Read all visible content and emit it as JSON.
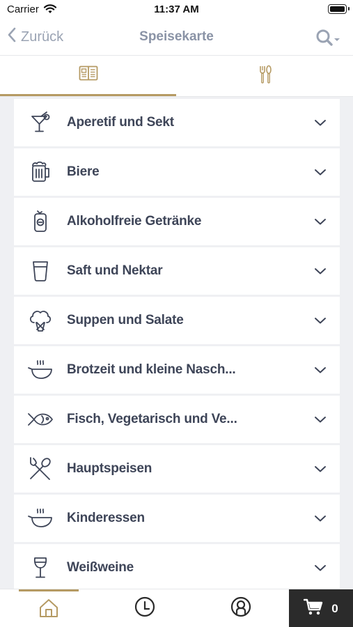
{
  "status": {
    "carrier": "Carrier",
    "time": "11:37 AM"
  },
  "nav": {
    "back_label": "Zurück",
    "title": "Speisekarte"
  },
  "tabs": [
    {
      "name": "menu-card",
      "icon": "menu-card-icon",
      "active": true
    },
    {
      "name": "cutlery",
      "icon": "cutlery-icon",
      "active": false
    }
  ],
  "categories": [
    {
      "label": "Aperetif und Sekt",
      "icon": "cocktail-icon"
    },
    {
      "label": "Biere",
      "icon": "beer-mug-icon"
    },
    {
      "label": "Alkoholfreie Getränke",
      "icon": "soda-can-icon"
    },
    {
      "label": "Saft und Nektar",
      "icon": "glass-icon"
    },
    {
      "label": "Suppen und Salate",
      "icon": "broccoli-icon"
    },
    {
      "label": "Brotzeit und kleine Nasch...",
      "icon": "hot-bowl-icon"
    },
    {
      "label": "Fisch, Vegetarisch und Ve...",
      "icon": "fish-icon"
    },
    {
      "label": "Hauptspeisen",
      "icon": "fork-spoon-icon"
    },
    {
      "label": "Kinderessen",
      "icon": "hot-bowl-icon"
    },
    {
      "label": "Weißweine",
      "icon": "wine-glass-icon"
    }
  ],
  "bottom": {
    "cart_count": "0"
  },
  "colors": {
    "accent": "#b59a63",
    "text": "#3e4558",
    "muted": "#8a93a6",
    "cart_bg": "#2b2b2b"
  }
}
